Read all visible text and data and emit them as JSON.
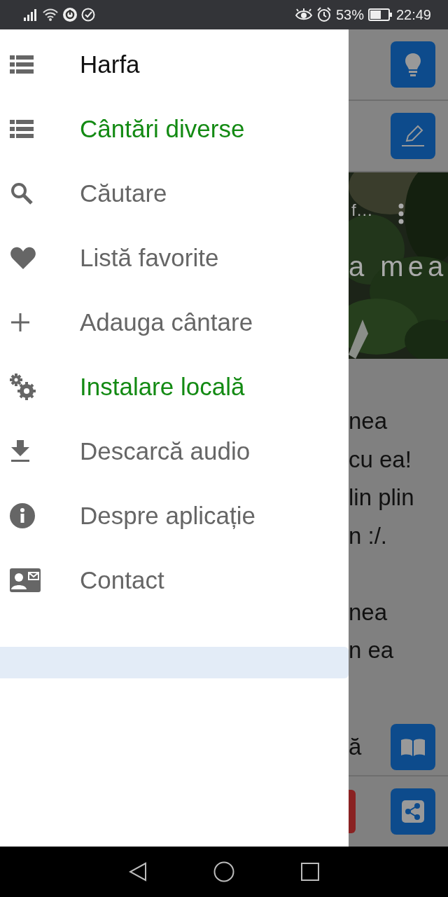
{
  "status_bar": {
    "battery": "53%",
    "time": "22:49"
  },
  "drawer": {
    "items": [
      {
        "label": "Harfa",
        "kind": "list",
        "color": "#111111"
      },
      {
        "label": "Cântări diverse",
        "kind": "list",
        "color": "#138a13"
      },
      {
        "label": "Căutare",
        "kind": "search",
        "color": "#666666"
      },
      {
        "label": "Listă favorite",
        "kind": "heart",
        "color": "#666666"
      },
      {
        "label": "Adauga cântare",
        "kind": "plus",
        "color": "#666666"
      },
      {
        "label": "Instalare locală",
        "kind": "gears",
        "color": "#138a13"
      },
      {
        "label": "Descarcă audio",
        "kind": "download",
        "color": "#666666"
      },
      {
        "label": "Despre aplicație",
        "kind": "info",
        "color": "#666666"
      },
      {
        "label": "Contact",
        "kind": "contact",
        "color": "#666666"
      }
    ]
  },
  "background": {
    "picture_title": "f…",
    "picture_caption": "a mea",
    "stanzas": [
      [
        "nea",
        "cu ea!",
        "lin plin",
        "n :/."
      ],
      [
        "nea",
        "n ea"
      ]
    ],
    "bottom_text": "ă"
  }
}
